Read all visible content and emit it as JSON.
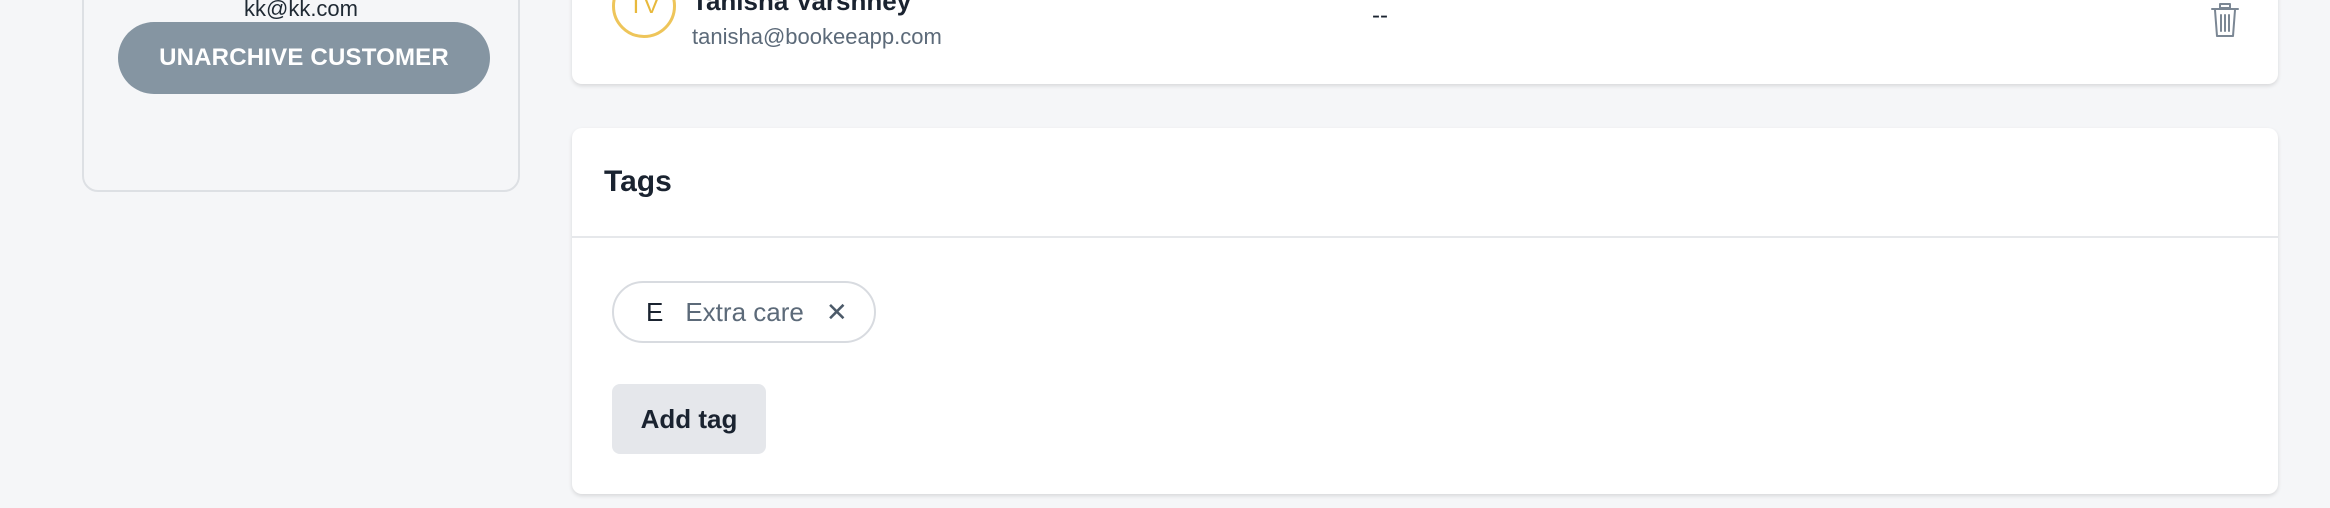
{
  "left_panel": {
    "email": "kk@kk.com",
    "unarchive_label": "UNARCHIVE CUSTOMER"
  },
  "contact": {
    "initials": "TV",
    "name": "Tanisha Varshney",
    "email": "tanisha@bookeeapp.com",
    "value": "--",
    "delete_icon": "trash-icon"
  },
  "tags": {
    "title": "Tags",
    "items": [
      {
        "initial": "E",
        "label": "Extra care",
        "remove_icon": "close-icon"
      }
    ],
    "add_label": "Add tag"
  },
  "colors": {
    "background": "#f5f6f8",
    "unarchive_button": "#8595a2",
    "avatar_accent": "#eec55a",
    "add_tag_button": "#e5e7eb"
  }
}
